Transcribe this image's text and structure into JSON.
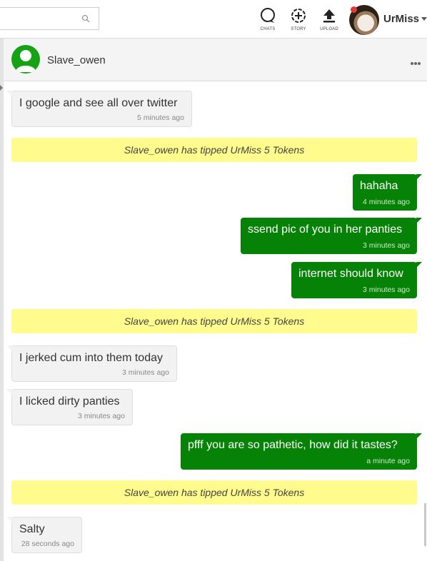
{
  "topbar": {
    "search": {
      "placeholder": "",
      "value": ""
    },
    "nav": [
      {
        "label": "CHATS",
        "icon": "chat-bubble-icon"
      },
      {
        "label": "STORY",
        "icon": "add-story-icon"
      },
      {
        "label": "UPLOAD",
        "icon": "upload-icon"
      }
    ],
    "user": {
      "name": "UrMiss"
    }
  },
  "chat": {
    "contact_name": "Slave_owen",
    "messages": [
      {
        "dir": "in",
        "text": "I google and see all over twitter",
        "time": "5 minutes ago"
      },
      {
        "dir": "tip",
        "text": "Slave_owen has tipped UrMiss 5 Tokens"
      },
      {
        "dir": "out",
        "text": "hahaha",
        "time": "4 minutes ago"
      },
      {
        "dir": "out",
        "text": "ssend pic of you in her panties",
        "time": "3 minutes ago"
      },
      {
        "dir": "out",
        "text": "internet should know",
        "time": "3 minutes ago"
      },
      {
        "dir": "tip",
        "text": "Slave_owen has tipped UrMiss 5 Tokens"
      },
      {
        "dir": "in",
        "text": "I jerked cum into them today",
        "time": "3 minutes ago"
      },
      {
        "dir": "in",
        "text": "I licked dirty panties",
        "time": "3 minutes ago"
      },
      {
        "dir": "out",
        "text": "pfff you are so pathetic, how did it tastes?",
        "time": "a minute ago"
      },
      {
        "dir": "tip",
        "text": "Slave_owen has tipped UrMiss 5 Tokens"
      },
      {
        "dir": "in",
        "text": "Salty",
        "time": "28 seconds ago"
      }
    ]
  },
  "colors": {
    "outgoing_bubble": "#068306",
    "incoming_bubble": "#f2f2f2",
    "tip_banner": "#fffb8c",
    "avatar_green": "#15a315"
  }
}
